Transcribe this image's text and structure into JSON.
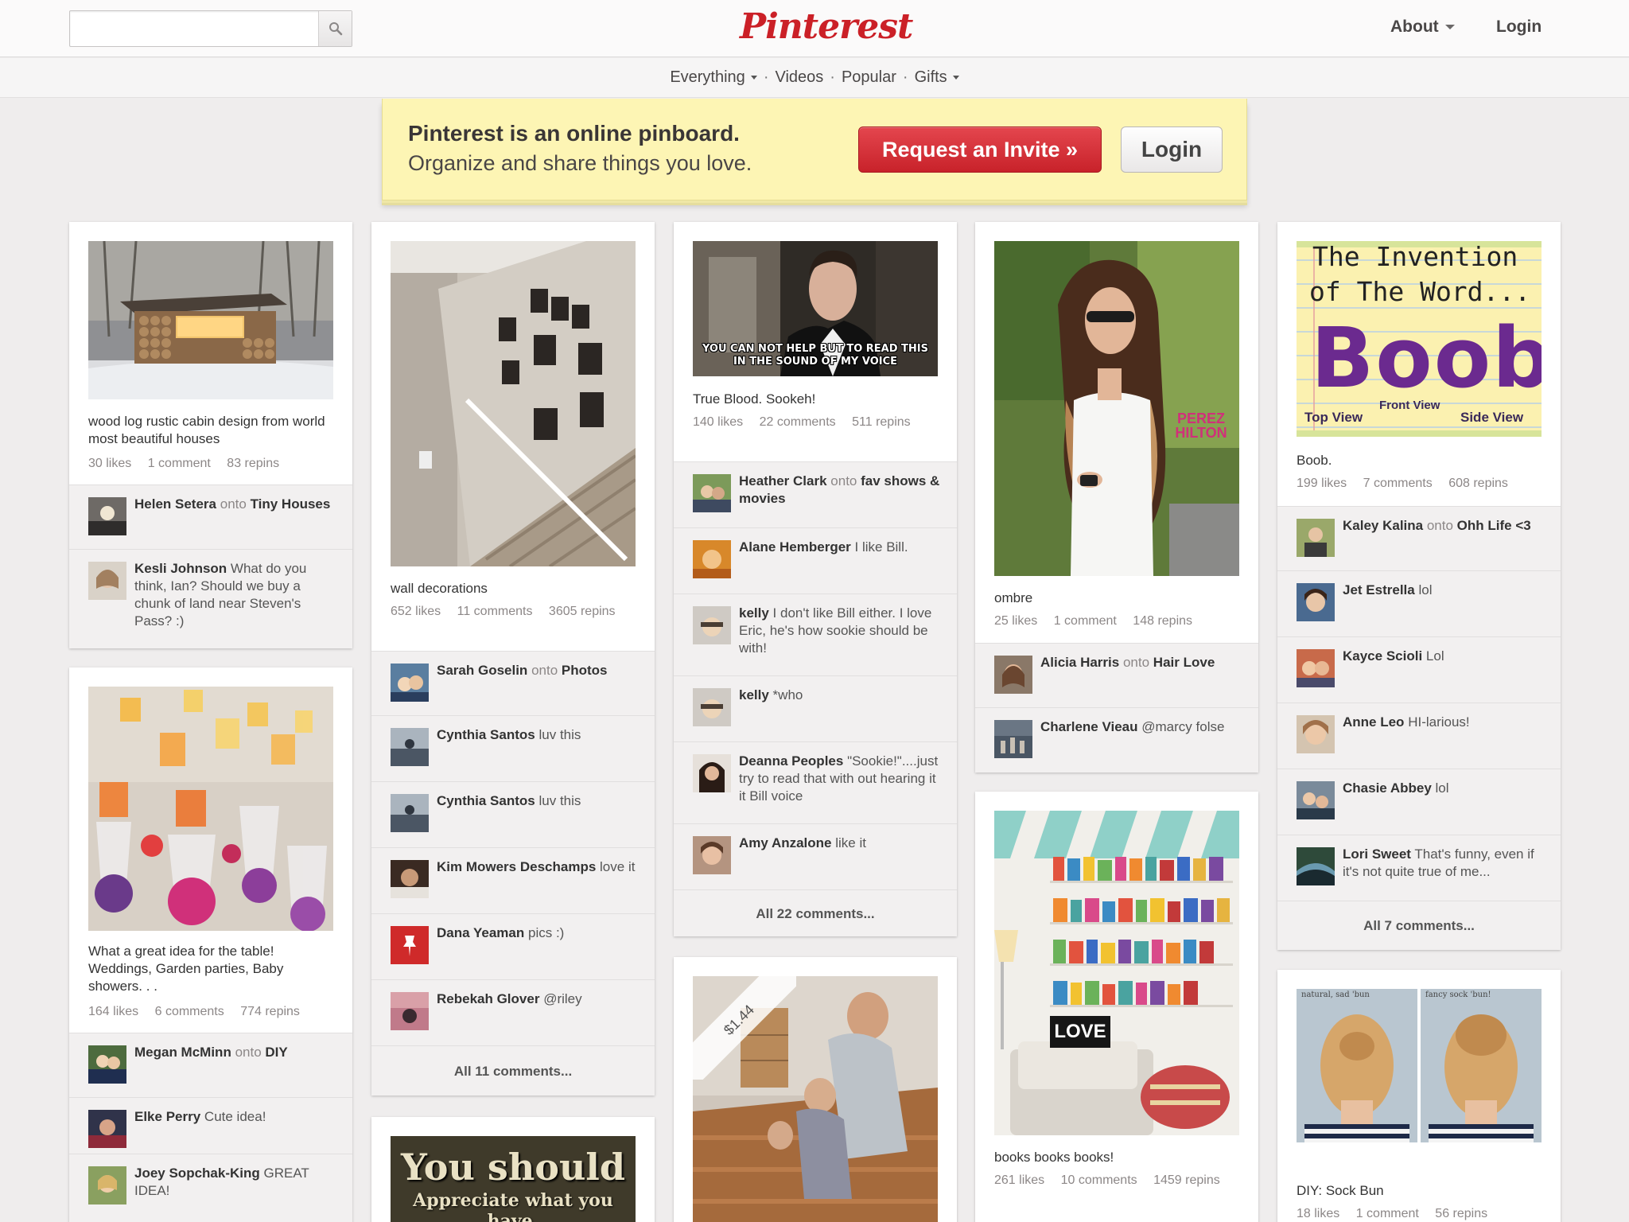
{
  "header": {
    "logo": "Pinterest",
    "search_placeholder": "",
    "about": "About",
    "login": "Login"
  },
  "subnav": {
    "everything": "Everything",
    "videos": "Videos",
    "popular": "Popular",
    "gifts": "Gifts",
    "separator": "·"
  },
  "banner": {
    "title": "Pinterest is an online pinboard.",
    "subtitle": "Organize and share things you love.",
    "invite_button": "Request an Invite »",
    "login_button": "Login"
  },
  "colors": {
    "brand": "#cb2027",
    "banner_bg": "#fdf5b4",
    "page_bg": "#efeded"
  },
  "pins": {
    "cabin": {
      "desc": "wood log rustic cabin design from world most beautiful houses",
      "likes": "30 likes",
      "comments": "1 comment",
      "repins": "83 repins",
      "c1_user": "Helen Setera",
      "c1_onto": "onto",
      "c1_board": "Tiny Houses",
      "c2_user": "Kesli Johnson",
      "c2_text": "What do you think, Ian? Should we buy a chunk of land near Steven's Pass? :)"
    },
    "table": {
      "desc": "What a great idea for the table! Weddings, Garden parties, Baby showers. . .",
      "likes": "164 likes",
      "comments": "6 comments",
      "repins": "774 repins",
      "c1_user": "Megan McMinn",
      "c1_onto": "onto",
      "c1_board": "DIY",
      "c2_user": "Elke Perry",
      "c2_text": "Cute idea!",
      "c3_user": "Joey Sopchak-King",
      "c3_text": "GREAT IDEA!"
    },
    "wall": {
      "desc": "wall decorations",
      "likes": "652 likes",
      "comments": "11 comments",
      "repins": "3605 repins",
      "c1_user": "Sarah Goselin",
      "c1_onto": "onto",
      "c1_board": "Photos",
      "c2_user": "Cynthia Santos",
      "c2_text": "luv this",
      "c3_user": "Cynthia Santos",
      "c3_text": "luv this",
      "c4_user": "Kim Mowers Deschamps",
      "c4_text": "love it",
      "c5_user": "Dana Yeaman",
      "c5_text": "pics :)",
      "c6_user": "Rebekah Glover",
      "c6_text": "@riley",
      "all": "All 11 comments..."
    },
    "you_should": {
      "line1": "You should",
      "line2": "Appreciate what you have,"
    },
    "trueblood": {
      "meme_text": "YOU CAN NOT HELP BUT TO READ THIS IN THE SOUND OF MY VOICE",
      "desc": "True Blood. Sookeh!",
      "likes": "140 likes",
      "comments": "22 comments",
      "repins": "511 repins",
      "c1_user": "Heather Clark",
      "c1_onto": "onto",
      "c1_board": "fav shows & movies",
      "c2_user": "Alane Hemberger",
      "c2_text": "I like Bill.",
      "c3_user": "kelly",
      "c3_text": "I don't like Bill either. I love Eric, he's how sookie should be with!",
      "c4_user": "kelly",
      "c4_text": "*who",
      "c5_user": "Deanna Peoples",
      "c5_text": "\"Sookie!\"....just try to read that with out hearing it it Bill voice",
      "c6_user": "Amy Anzalone",
      "c6_text": "like it",
      "all": "All 22 comments..."
    },
    "pennies": {
      "price": "$1.44"
    },
    "ombre": {
      "watermark": "PEREZ HILTON",
      "desc": "ombre",
      "likes": "25 likes",
      "comments": "1 comment",
      "repins": "148 repins",
      "c1_user": "Alicia Harris",
      "c1_onto": "onto",
      "c1_board": "Hair Love",
      "c2_user": "Charlene Vieau",
      "c2_text": "@marcy folse"
    },
    "books": {
      "pillow_text": "LOVE",
      "desc": "books books books!",
      "likes": "261 likes",
      "comments": "10 comments",
      "repins": "1459 repins"
    },
    "boob": {
      "line1": "The Invention",
      "line2": "of The Word...",
      "big": "Boob",
      "lbl_top": "Top View",
      "lbl_front": "Front View",
      "lbl_side": "Side View",
      "desc": "Boob.",
      "likes": "199 likes",
      "comments": "7 comments",
      "repins": "608 repins",
      "c1_user": "Kaley Kalina",
      "c1_onto": "onto",
      "c1_board": "Ohh Life <3",
      "c2_user": "Jet Estrella",
      "c2_text": "lol",
      "c3_user": "Kayce Scioli",
      "c3_text": "Lol",
      "c4_user": "Anne Leo",
      "c4_text": "HI-larious!",
      "c5_user": "Chasie Abbey",
      "c5_text": "lol",
      "c6_user": "Lori Sweet",
      "c6_text": "That's funny, even if it's not quite true of me...",
      "all": "All 7 comments..."
    },
    "sockbun": {
      "lbl_left": "natural, sad 'bun",
      "lbl_right": "fancy sock 'bun!",
      "desc": "DIY: Sock Bun",
      "likes": "18 likes",
      "comments": "1 comment",
      "repins": "56 repins"
    }
  }
}
